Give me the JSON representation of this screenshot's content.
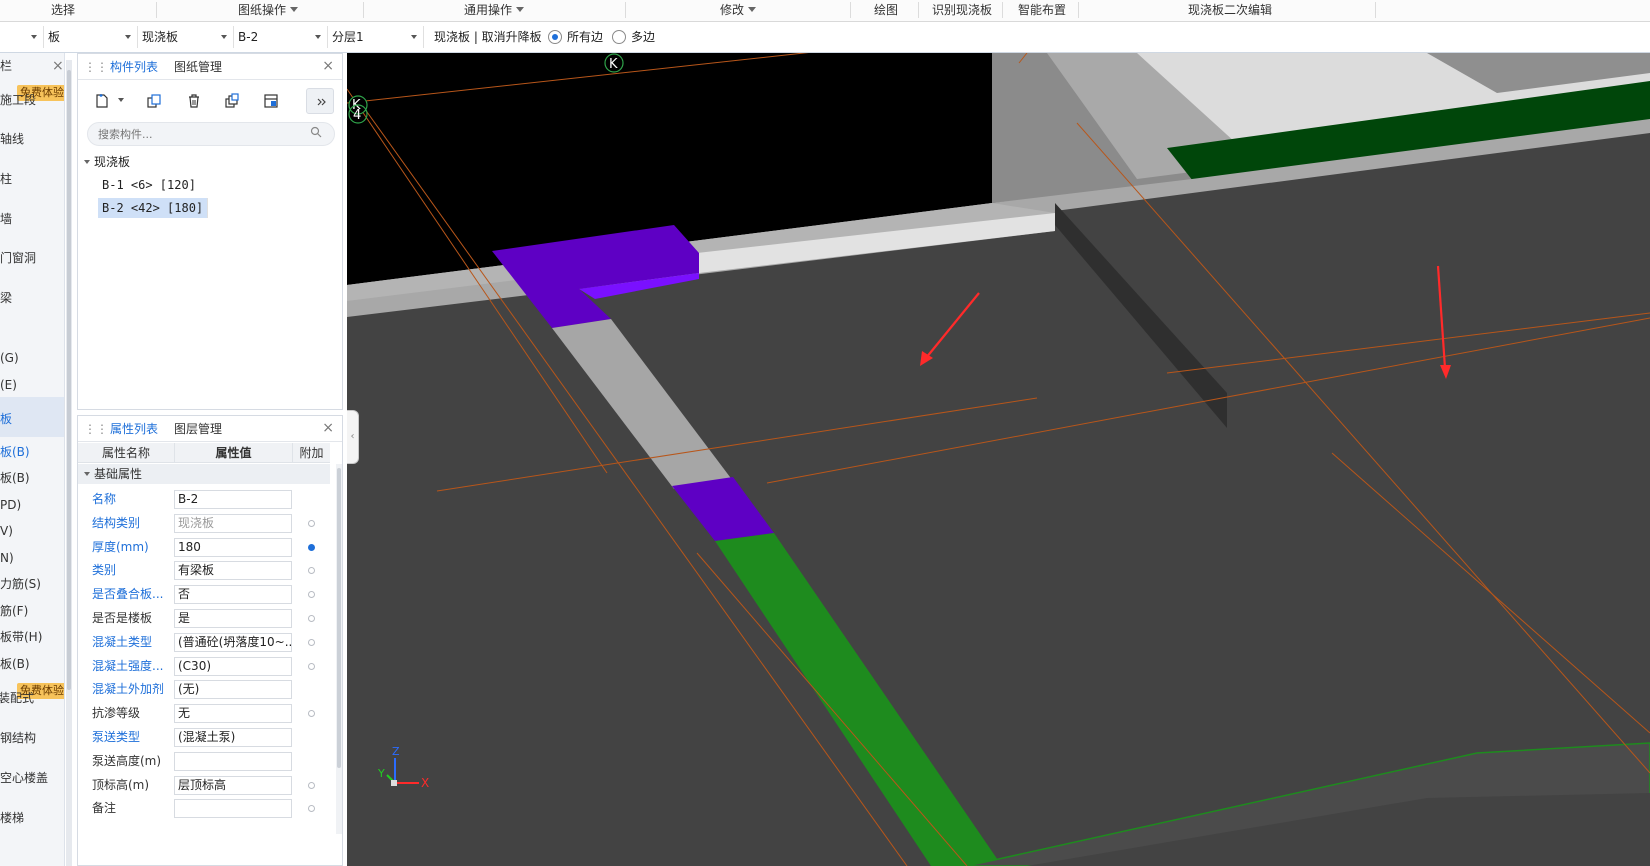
{
  "ribbon": {
    "groups": [
      "选择",
      "图纸操作",
      "通用操作",
      "修改",
      "绘图",
      "识别现浇板",
      "智能布置",
      "现浇板二次编辑"
    ]
  },
  "selbar": {
    "floor_value": "",
    "category": "板",
    "type": "现浇板",
    "component": "B-2",
    "layer": "分层1",
    "mode_text": "现浇板 | 取消升降板",
    "radio_all": "所有边",
    "radio_multi": "多边"
  },
  "leftnav": {
    "section_title": "栏",
    "items": [
      "施工段",
      "轴线",
      "柱",
      "墙",
      "门窗洞",
      "梁",
      "(G)",
      "(E)",
      "板",
      "板(B)",
      "板(B)",
      "PD)",
      "V)",
      "N)",
      "力筋(S)",
      "筋(F)",
      "板带(H)",
      "板(B)",
      "装配式",
      "钢结构",
      "空心楼盖",
      "楼梯"
    ],
    "badge": "免费体验"
  },
  "component_panel": {
    "tabs": [
      "构件列表",
      "图纸管理"
    ],
    "search_placeholder": "搜索构件...",
    "tree": {
      "root": "现浇板",
      "children": [
        "B-1 <6> [120]",
        "B-2 <42> [180]"
      ]
    }
  },
  "property_panel": {
    "tabs": [
      "属性列表",
      "图层管理"
    ],
    "columns": [
      "属性名称",
      "属性值",
      "附加"
    ],
    "group": "基础属性",
    "rows": [
      {
        "name": "名称",
        "value": "B-2",
        "blue": true,
        "attach": "none"
      },
      {
        "name": "结构类别",
        "value": "现浇板",
        "blue": true,
        "attach": "off",
        "gray": true
      },
      {
        "name": "厚度(mm)",
        "value": "180",
        "blue": true,
        "attach": "on"
      },
      {
        "name": "类别",
        "value": "有梁板",
        "blue": true,
        "attach": "off"
      },
      {
        "name": "是否叠合板...",
        "value": "否",
        "blue": true,
        "attach": "off"
      },
      {
        "name": "是否是楼板",
        "value": "是",
        "blue": false,
        "attach": "off"
      },
      {
        "name": "混凝土类型",
        "value": "(普通砼(坍落度10~...",
        "blue": true,
        "attach": "off"
      },
      {
        "name": "混凝土强度...",
        "value": "(C30)",
        "blue": true,
        "attach": "off"
      },
      {
        "name": "混凝土外加剂",
        "value": "(无)",
        "blue": true,
        "attach": "none"
      },
      {
        "name": "抗渗等级",
        "value": "无",
        "blue": false,
        "attach": "off"
      },
      {
        "name": "泵送类型",
        "value": "(混凝土泵)",
        "blue": true,
        "attach": "none"
      },
      {
        "name": "泵送高度(m)",
        "value": "",
        "blue": false,
        "attach": "none"
      },
      {
        "name": "顶标高(m)",
        "value": "层顶标高",
        "blue": false,
        "attach": "off"
      },
      {
        "name": "备注",
        "value": "",
        "blue": false,
        "attach": "off"
      }
    ]
  },
  "viewport": {
    "grid_labels": [
      "K",
      "K",
      "4"
    ],
    "axis_labels": [
      "Z",
      "Y",
      "X"
    ]
  },
  "colors": {
    "accent": "#1e6fd9",
    "viewport_bg": "#434343",
    "beam_light": "#9e9e9e",
    "beam_purple": "#6a00d8",
    "beam_green": "#1e8b1e",
    "beam_darkgreen": "#00460a",
    "grid_line": "#b8561a"
  }
}
